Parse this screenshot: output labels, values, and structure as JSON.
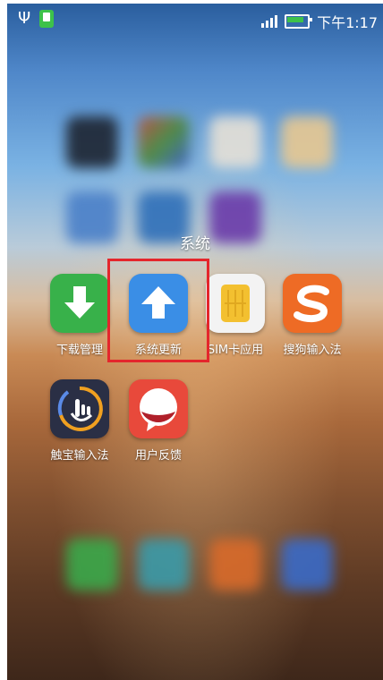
{
  "status_bar": {
    "time": "下午1:17",
    "usb_icon": "usb-icon",
    "app_notification_icon": "phone-green-icon",
    "signal_icon": "signal-bars-icon",
    "battery_icon": "battery-charging-icon"
  },
  "folder": {
    "title": "系统",
    "apps": [
      {
        "label": "下载管理",
        "icon": "download-icon",
        "color": "#38b14a"
      },
      {
        "label": "系统更新",
        "icon": "update-arrow-icon",
        "color": "#3a8ee6"
      },
      {
        "label": "SIM卡应用",
        "icon": "sim-card-icon",
        "color": "#f3c030"
      },
      {
        "label": "搜狗输入法",
        "icon": "sogou-s-icon",
        "color": "#ee6b25"
      },
      {
        "label": "触宝输入法",
        "icon": "touchpal-icon",
        "color": "#2a2f45"
      },
      {
        "label": "用户反馈",
        "icon": "feedback-icon",
        "color": "#e8493b"
      }
    ]
  },
  "highlight_color": "#e4262c"
}
